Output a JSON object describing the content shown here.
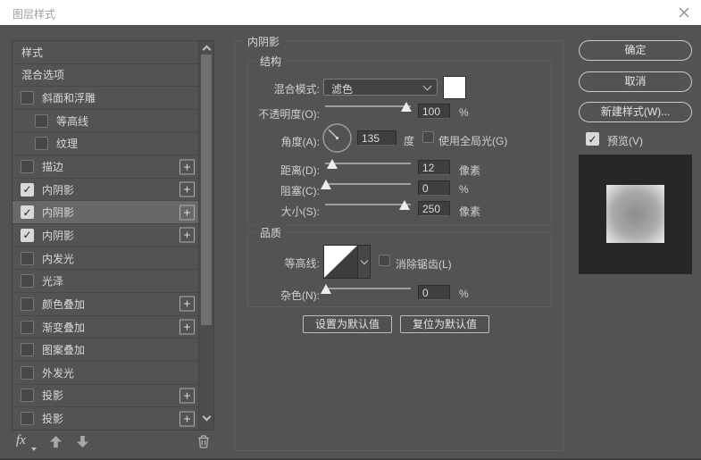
{
  "window": {
    "title": "图层样式"
  },
  "icons": {
    "check_glyph": "✓",
    "plus_glyph": "+"
  },
  "sidebar": {
    "items": [
      {
        "label": "样式",
        "type": "plain"
      },
      {
        "label": "混合选项",
        "type": "plain"
      },
      {
        "label": "斜面和浮雕",
        "type": "check",
        "checked": false
      },
      {
        "label": "等高线",
        "type": "check",
        "checked": false,
        "indent": true
      },
      {
        "label": "纹理",
        "type": "check",
        "checked": false,
        "indent": true
      },
      {
        "label": "描边",
        "type": "check",
        "checked": false,
        "plus": true
      },
      {
        "label": "内阴影",
        "type": "check",
        "checked": true,
        "plus": true
      },
      {
        "label": "内阴影",
        "type": "check",
        "checked": true,
        "plus": true,
        "selected": true
      },
      {
        "label": "内阴影",
        "type": "check",
        "checked": true,
        "plus": true
      },
      {
        "label": "内发光",
        "type": "check",
        "checked": false
      },
      {
        "label": "光泽",
        "type": "check",
        "checked": false
      },
      {
        "label": "颜色叠加",
        "type": "check",
        "checked": false,
        "plus": true
      },
      {
        "label": "渐变叠加",
        "type": "check",
        "checked": false,
        "plus": true
      },
      {
        "label": "图案叠加",
        "type": "check",
        "checked": false
      },
      {
        "label": "外发光",
        "type": "check",
        "checked": false
      },
      {
        "label": "投影",
        "type": "check",
        "checked": false,
        "plus": true
      },
      {
        "label": "投影",
        "type": "check",
        "checked": false,
        "plus": true
      }
    ],
    "footer": {
      "fx_label": "fx"
    }
  },
  "panel": {
    "legend": "内阴影",
    "structure": {
      "legend": "结构",
      "blend_mode_label": "混合模式:",
      "blend_mode_value": "滤色",
      "opacity_label": "不透明度(O):",
      "opacity_value": "100",
      "opacity_unit": "%",
      "opacity_percent": 95,
      "angle_label": "角度(A):",
      "angle_value": "135",
      "angle_unit": "度",
      "global_light_label": "使用全局光(G)",
      "global_light_checked": false,
      "distance_label": "距离(D):",
      "distance_value": "12",
      "distance_unit": "像素",
      "distance_percent": 8,
      "choke_label": "阻塞(C):",
      "choke_value": "0",
      "choke_unit": "%",
      "choke_percent": 1,
      "size_label": "大小(S):",
      "size_value": "250",
      "size_unit": "像素",
      "size_percent": 93
    },
    "quality": {
      "legend": "品质",
      "contour_label": "等高线:",
      "antialias_label": "消除锯齿(L)",
      "antialias_checked": false,
      "noise_label": "杂色(N):",
      "noise_value": "0",
      "noise_unit": "%",
      "noise_percent": 1
    },
    "buttons": {
      "set_default": "设置为默认值",
      "reset_default": "复位为默认值"
    }
  },
  "actions": {
    "ok": "确定",
    "cancel": "取消",
    "new_style": "新建样式(W)...",
    "preview_label": "预览(V)",
    "preview_checked": true
  },
  "colors": {
    "dialog_bg": "#535353",
    "titlebar_bg": "#ffffff",
    "selected_row": "#686868",
    "input_bg": "#3e3e3e",
    "swatch": "#ffffff",
    "preview_bg": "#272727"
  }
}
